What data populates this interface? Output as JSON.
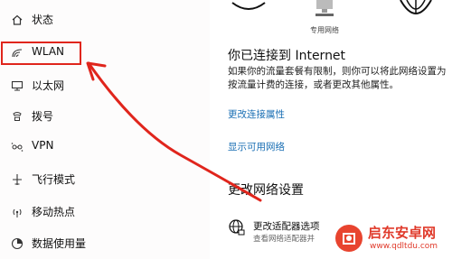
{
  "sidebar": {
    "items": [
      {
        "label": "状态",
        "icon": "home-icon"
      },
      {
        "label": "WLAN",
        "icon": "wifi-icon"
      },
      {
        "label": "以太网",
        "icon": "ethernet-icon"
      },
      {
        "label": "拨号",
        "icon": "phone-icon"
      },
      {
        "label": "VPN",
        "icon": "vpn-icon"
      },
      {
        "label": "飞行模式",
        "icon": "airplane-icon"
      },
      {
        "label": "移动热点",
        "icon": "hotspot-icon"
      },
      {
        "label": "数据使用量",
        "icon": "data-usage-icon"
      }
    ]
  },
  "main": {
    "network_caption": "专用网络",
    "status_title": "你已连接到 Internet",
    "status_desc": "如果你的流量套餐有限制，则你可以将此网络设置为按流量计费的连接，或者更改其他属性。",
    "link_change_properties": "更改连接属性",
    "link_show_networks": "显示可用网络",
    "section_title": "更改网络设置",
    "adapter_title": "更改适配器选项",
    "adapter_sub": "查看网络适配器并"
  },
  "watermark": {
    "name": "启东安卓网",
    "url": "www.qdltdu.com"
  },
  "colors": {
    "highlight": "#e0251c",
    "link": "#1a6fb4"
  }
}
